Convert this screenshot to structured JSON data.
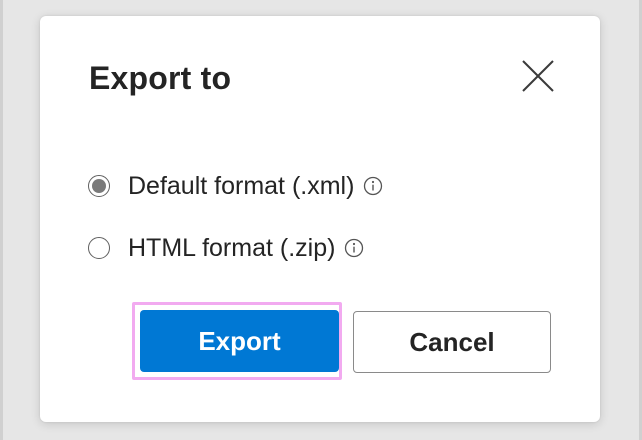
{
  "dialog": {
    "title": "Export to",
    "options": [
      {
        "label": "Default format (.xml)",
        "selected": true,
        "info_icon": "info-icon"
      },
      {
        "label": "HTML format (.zip)",
        "selected": false,
        "info_icon": "info-icon"
      }
    ],
    "buttons": {
      "primary_label": "Export",
      "secondary_label": "Cancel"
    },
    "close_icon": "close-icon"
  },
  "colors": {
    "primary": "#0078d4",
    "focus_ring": "#f2aaf0",
    "text": "#242424"
  }
}
